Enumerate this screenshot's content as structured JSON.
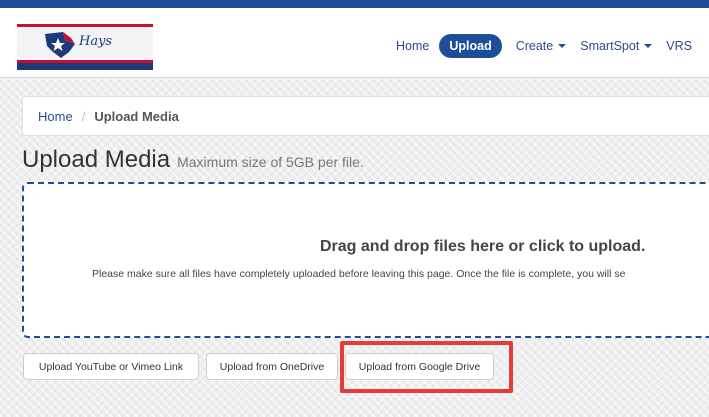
{
  "logo": {
    "text": "Hays"
  },
  "nav": {
    "items": [
      {
        "label": "Home",
        "active": false,
        "dropdown": false
      },
      {
        "label": "Upload",
        "active": true,
        "dropdown": false
      },
      {
        "label": "Create",
        "active": false,
        "dropdown": true
      },
      {
        "label": "SmartSpot",
        "active": false,
        "dropdown": true
      },
      {
        "label": "VRS",
        "active": false,
        "dropdown": false
      }
    ]
  },
  "breadcrumb": {
    "home": "Home",
    "separator": "/",
    "current": "Upload Media"
  },
  "page": {
    "title": "Upload Media",
    "subtitle": "Maximum size of 5GB per file."
  },
  "dropzone": {
    "main": "Drag and drop files here or click to upload.",
    "note": "Please make sure all files have completely uploaded before leaving this page. Once the file is complete, you will se"
  },
  "buttons": {
    "youtube": "Upload YouTube or Vimeo Link",
    "onedrive": "Upload from OneDrive",
    "gdrive": "Upload from Google Drive"
  },
  "colors": {
    "brand_blue": "#1f4e99",
    "highlight_red": "#e63b3b",
    "logo_red": "#c8102e",
    "logo_navy": "#1b3a78"
  }
}
